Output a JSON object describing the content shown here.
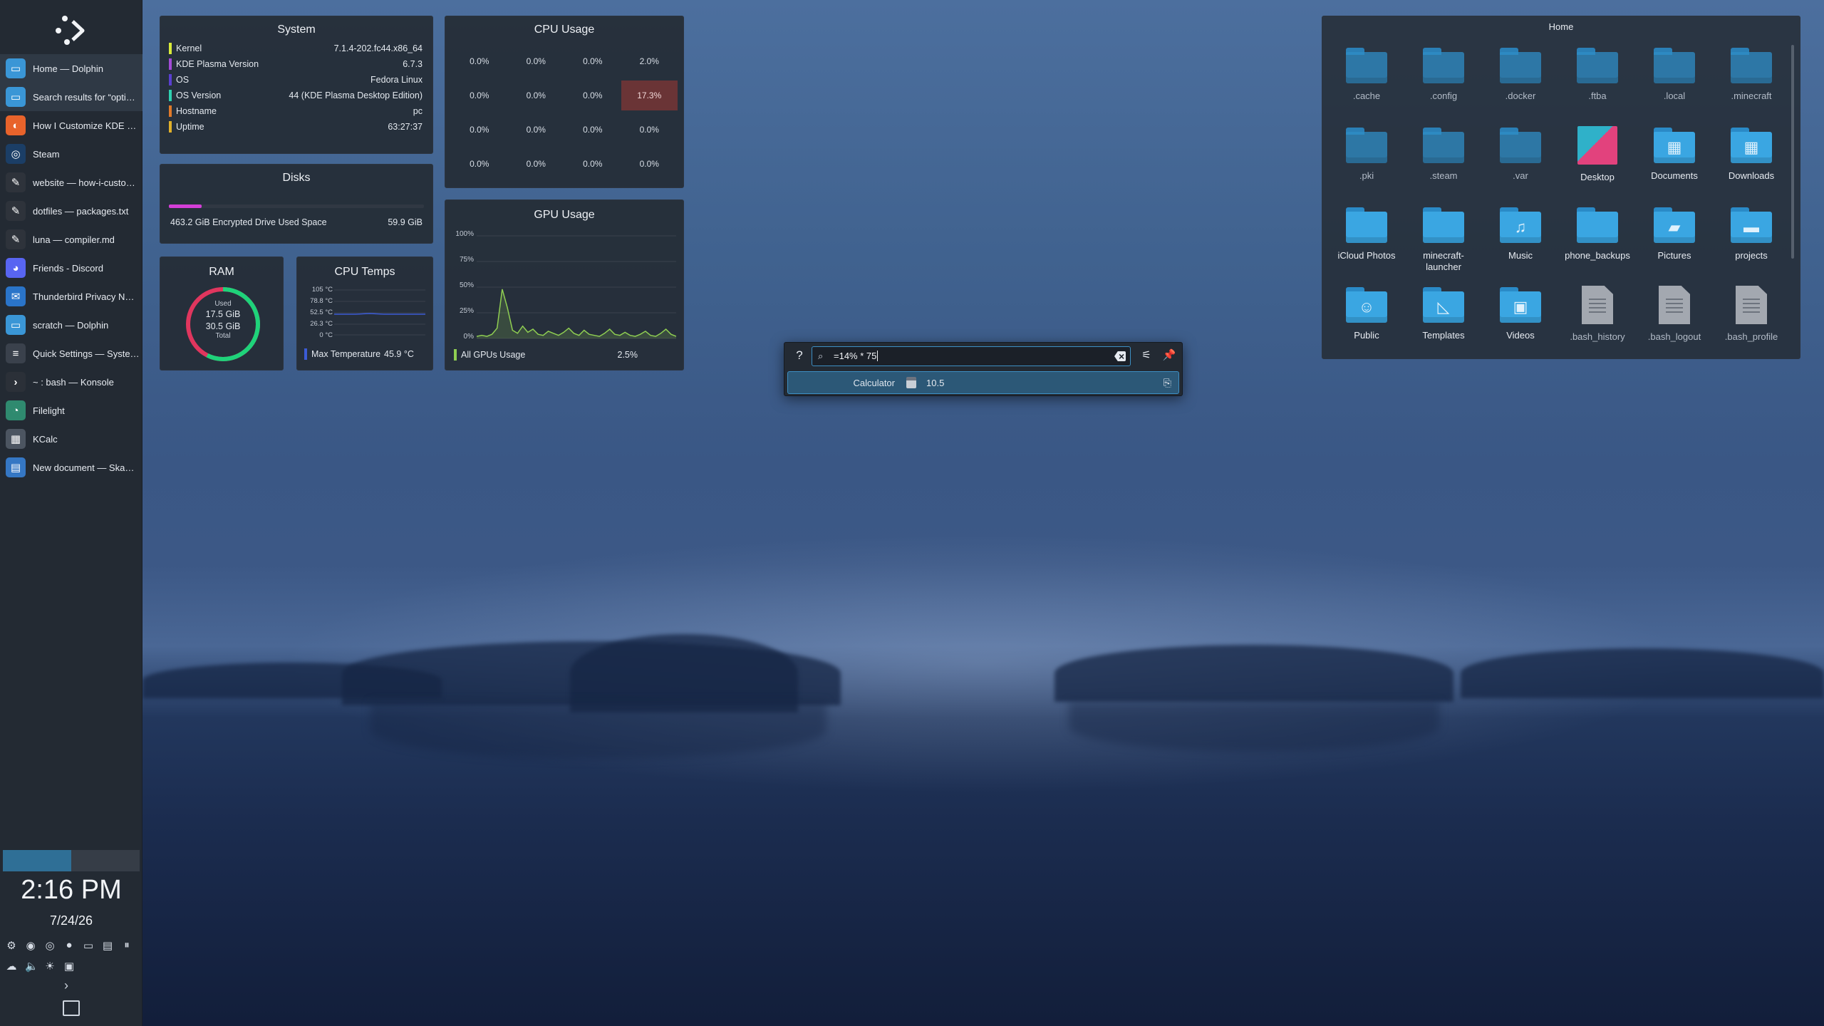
{
  "colors": {
    "accent": "#3d8fc4",
    "panel": "#232a33",
    "cpu_hot": "#6a3436",
    "gpu_line": "#8fce52",
    "ram_used": "#1ed37a",
    "ram_total": "#e0365e",
    "disk_bar": "#d43fd8"
  },
  "taskbar": {
    "launcher_icon": "plasma-launcher-icon",
    "tasks": [
      {
        "label": "Home — Dolphin",
        "icon": "dolphin-icon"
      },
      {
        "label": "Search results for “opti…",
        "icon": "dolphin-icon"
      },
      {
        "label": "How I Customize KDE …",
        "icon": "firefox-icon"
      },
      {
        "label": "Steam",
        "icon": "steam-icon"
      },
      {
        "label": "website — how-i-custo…",
        "icon": "editor-icon"
      },
      {
        "label": "dotfiles — packages.txt",
        "icon": "editor-icon"
      },
      {
        "label": "luna — compiler.md",
        "icon": "editor-icon"
      },
      {
        "label": "Friends - Discord",
        "icon": "discord-icon"
      },
      {
        "label": "Thunderbird Privacy N…",
        "icon": "thunderbird-icon"
      },
      {
        "label": "scratch — Dolphin",
        "icon": "dolphin-icon"
      },
      {
        "label": "Quick Settings — Syste…",
        "icon": "system-settings-icon"
      },
      {
        "label": "~ : bash — Konsole",
        "icon": "konsole-icon"
      },
      {
        "label": "Filelight",
        "icon": "filelight-icon"
      },
      {
        "label": "KCalc",
        "icon": "kcalc-icon"
      },
      {
        "label": "New document — Ska…",
        "icon": "skanpage-icon"
      }
    ],
    "clock_time": "2:16 PM",
    "clock_date": "7/24/26"
  },
  "system_widget": {
    "title": "System",
    "rows": [
      {
        "label": "Kernel",
        "value": "7.1.4-202.fc44.x86_64",
        "color": "#d9ea3a"
      },
      {
        "label": "KDE Plasma Version",
        "value": "6.7.3",
        "color": "#a24bd6"
      },
      {
        "label": "OS",
        "value": "Fedora Linux",
        "color": "#5a3fd0"
      },
      {
        "label": "OS Version",
        "value": "44 (KDE Plasma Desktop Edition)",
        "color": "#2fd0b0"
      },
      {
        "label": "Hostname",
        "value": "pc",
        "color": "#e07a2a"
      },
      {
        "label": "Uptime",
        "value": "63:27:37",
        "color": "#e0b02a"
      }
    ]
  },
  "disks_widget": {
    "title": "Disks",
    "label": "463.2 GiB Encrypted Drive Used Space",
    "value": "59.9 GiB",
    "fill_fraction": 0.129
  },
  "cpu_widget": {
    "title": "CPU Usage",
    "cells": [
      "0.0%",
      "0.0%",
      "0.0%",
      "2.0%",
      "0.0%",
      "0.0%",
      "0.0%",
      "17.3%",
      "0.0%",
      "0.0%",
      "0.0%",
      "0.0%",
      "0.0%",
      "0.0%",
      "0.0%",
      "0.0%"
    ],
    "hot_index": 7
  },
  "gpu_widget": {
    "title": "GPU Usage",
    "ticks": [
      "100%",
      "75%",
      "50%",
      "25%",
      "0%"
    ],
    "legend_label": "All GPUs Usage",
    "legend_value": "2.5%",
    "history": [
      2,
      3,
      2,
      4,
      10,
      48,
      30,
      8,
      5,
      12,
      6,
      9,
      4,
      3,
      7,
      5,
      3,
      6,
      10,
      5,
      3,
      8,
      4,
      3,
      2,
      5,
      9,
      4,
      3,
      6,
      3,
      2,
      4,
      7,
      3,
      2,
      5,
      9,
      4,
      2
    ]
  },
  "ram_widget": {
    "title": "RAM",
    "used_label": "Used",
    "used_value": "17.5 GiB",
    "total_value": "30.5 GiB",
    "total_label": "Total",
    "used_fraction": 0.574
  },
  "temps_widget": {
    "title": "CPU Temps",
    "ticks": [
      "105 °C",
      "78.8 °C",
      "52.5 °C",
      "26.3 °C",
      "0 °C"
    ],
    "legend_label": "Max Temperature",
    "legend_value": "45.9 °C"
  },
  "krunner": {
    "query": "=14% * 75",
    "result_source": "Calculator",
    "result_value": "10.5"
  },
  "folder_view": {
    "title": "Home",
    "items": [
      {
        "name": ".cache",
        "kind": "folder",
        "hidden": true
      },
      {
        "name": ".config",
        "kind": "folder",
        "hidden": true
      },
      {
        "name": ".docker",
        "kind": "folder",
        "hidden": true
      },
      {
        "name": ".ftba",
        "kind": "folder",
        "hidden": true
      },
      {
        "name": ".local",
        "kind": "folder",
        "hidden": true
      },
      {
        "name": ".minecraft",
        "kind": "folder",
        "hidden": true
      },
      {
        "name": ".pki",
        "kind": "folder",
        "hidden": true
      },
      {
        "name": ".steam",
        "kind": "folder",
        "hidden": true
      },
      {
        "name": ".var",
        "kind": "folder",
        "hidden": true
      },
      {
        "name": "Desktop",
        "kind": "desktop"
      },
      {
        "name": "Documents",
        "kind": "documents"
      },
      {
        "name": "Downloads",
        "kind": "downloads"
      },
      {
        "name": "iCloud Photos",
        "kind": "folder"
      },
      {
        "name": "minecraft-launcher",
        "kind": "folder"
      },
      {
        "name": "Music",
        "kind": "music"
      },
      {
        "name": "phone_backups",
        "kind": "folder"
      },
      {
        "name": "Pictures",
        "kind": "pictures"
      },
      {
        "name": "projects",
        "kind": "projects"
      },
      {
        "name": "Public",
        "kind": "public"
      },
      {
        "name": "Templates",
        "kind": "templates"
      },
      {
        "name": "Videos",
        "kind": "videos"
      },
      {
        "name": ".bash_history",
        "kind": "file",
        "hidden": true
      },
      {
        "name": ".bash_logout",
        "kind": "file",
        "hidden": true
      },
      {
        "name": ".bash_profile",
        "kind": "file",
        "hidden": true
      }
    ]
  }
}
